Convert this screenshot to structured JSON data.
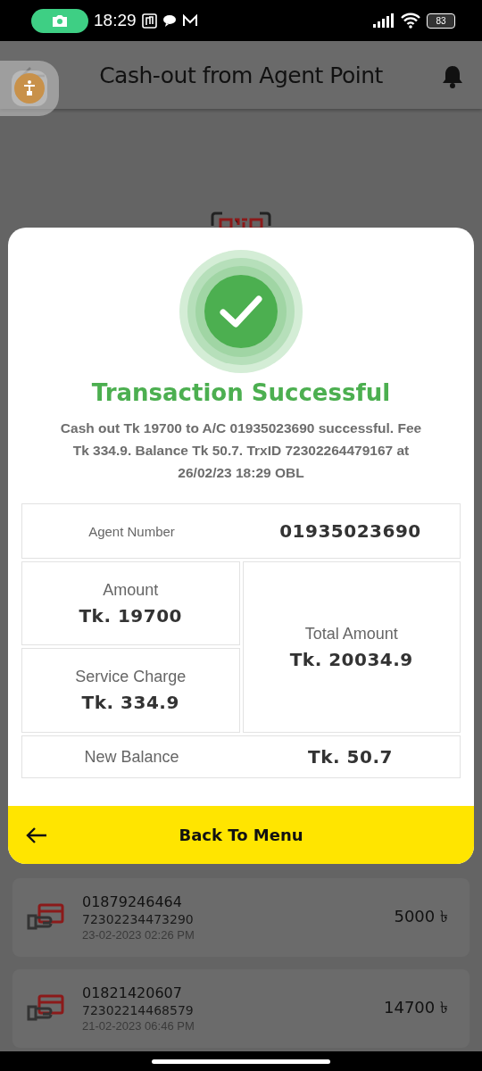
{
  "status_bar": {
    "time": "18:29",
    "battery": "83"
  },
  "header": {
    "title": "Cash-out from Agent Point"
  },
  "dialog": {
    "title": "Transaction Successful",
    "message": "Cash out Tk 19700 to A/C 01935023690 successful. Fee Tk 334.9. Balance Tk 50.7. TrxID 72302264479167 at 26/02/23 18:29 OBL",
    "agent_number": {
      "label": "Agent Number",
      "value": "01935023690"
    },
    "amount": {
      "label": "Amount",
      "value": "Tk. 19700"
    },
    "service_charge": {
      "label": "Service Charge",
      "value": "Tk. 334.9"
    },
    "total_amount": {
      "label": "Total Amount",
      "value": "Tk. 20034.9"
    },
    "new_balance": {
      "label": "New Balance",
      "value": "Tk. 50.7"
    },
    "button": {
      "label": "Back To Menu"
    }
  },
  "transactions": [
    {
      "number": "01879246464",
      "trx_id": "72302234473290",
      "date": "23-02-2023 02:26 PM",
      "amount": "5000 ৳"
    },
    {
      "number": "01821420607",
      "trx_id": "72302214468579",
      "date": "21-02-2023 06:46 PM",
      "amount": "14700 ৳"
    }
  ]
}
